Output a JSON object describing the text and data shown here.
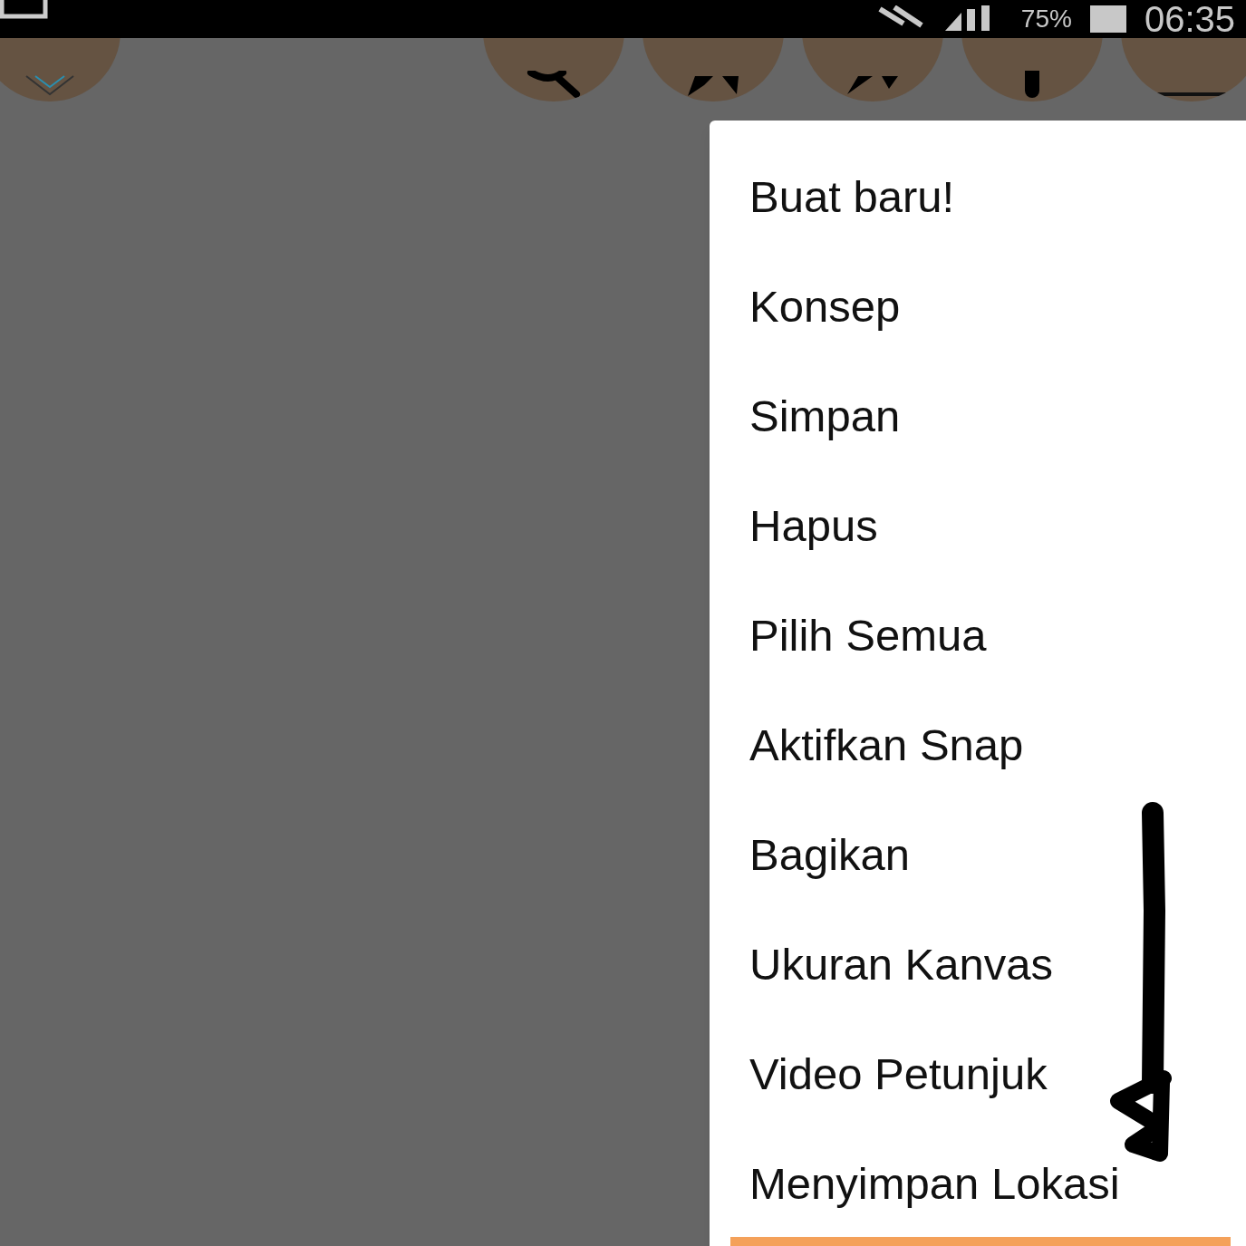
{
  "status_bar": {
    "battery": "75%",
    "time": "06:35"
  },
  "menu": {
    "items": [
      {
        "label": "Buat baru!"
      },
      {
        "label": "Konsep"
      },
      {
        "label": "Simpan"
      },
      {
        "label": "Hapus"
      },
      {
        "label": "Pilih Semua"
      },
      {
        "label": "Aktifkan Snap"
      },
      {
        "label": "Bagikan"
      },
      {
        "label": "Ukuran Kanvas"
      },
      {
        "label": "Video Petunjuk"
      },
      {
        "label": "Menyimpan Lokasi"
      }
    ]
  }
}
